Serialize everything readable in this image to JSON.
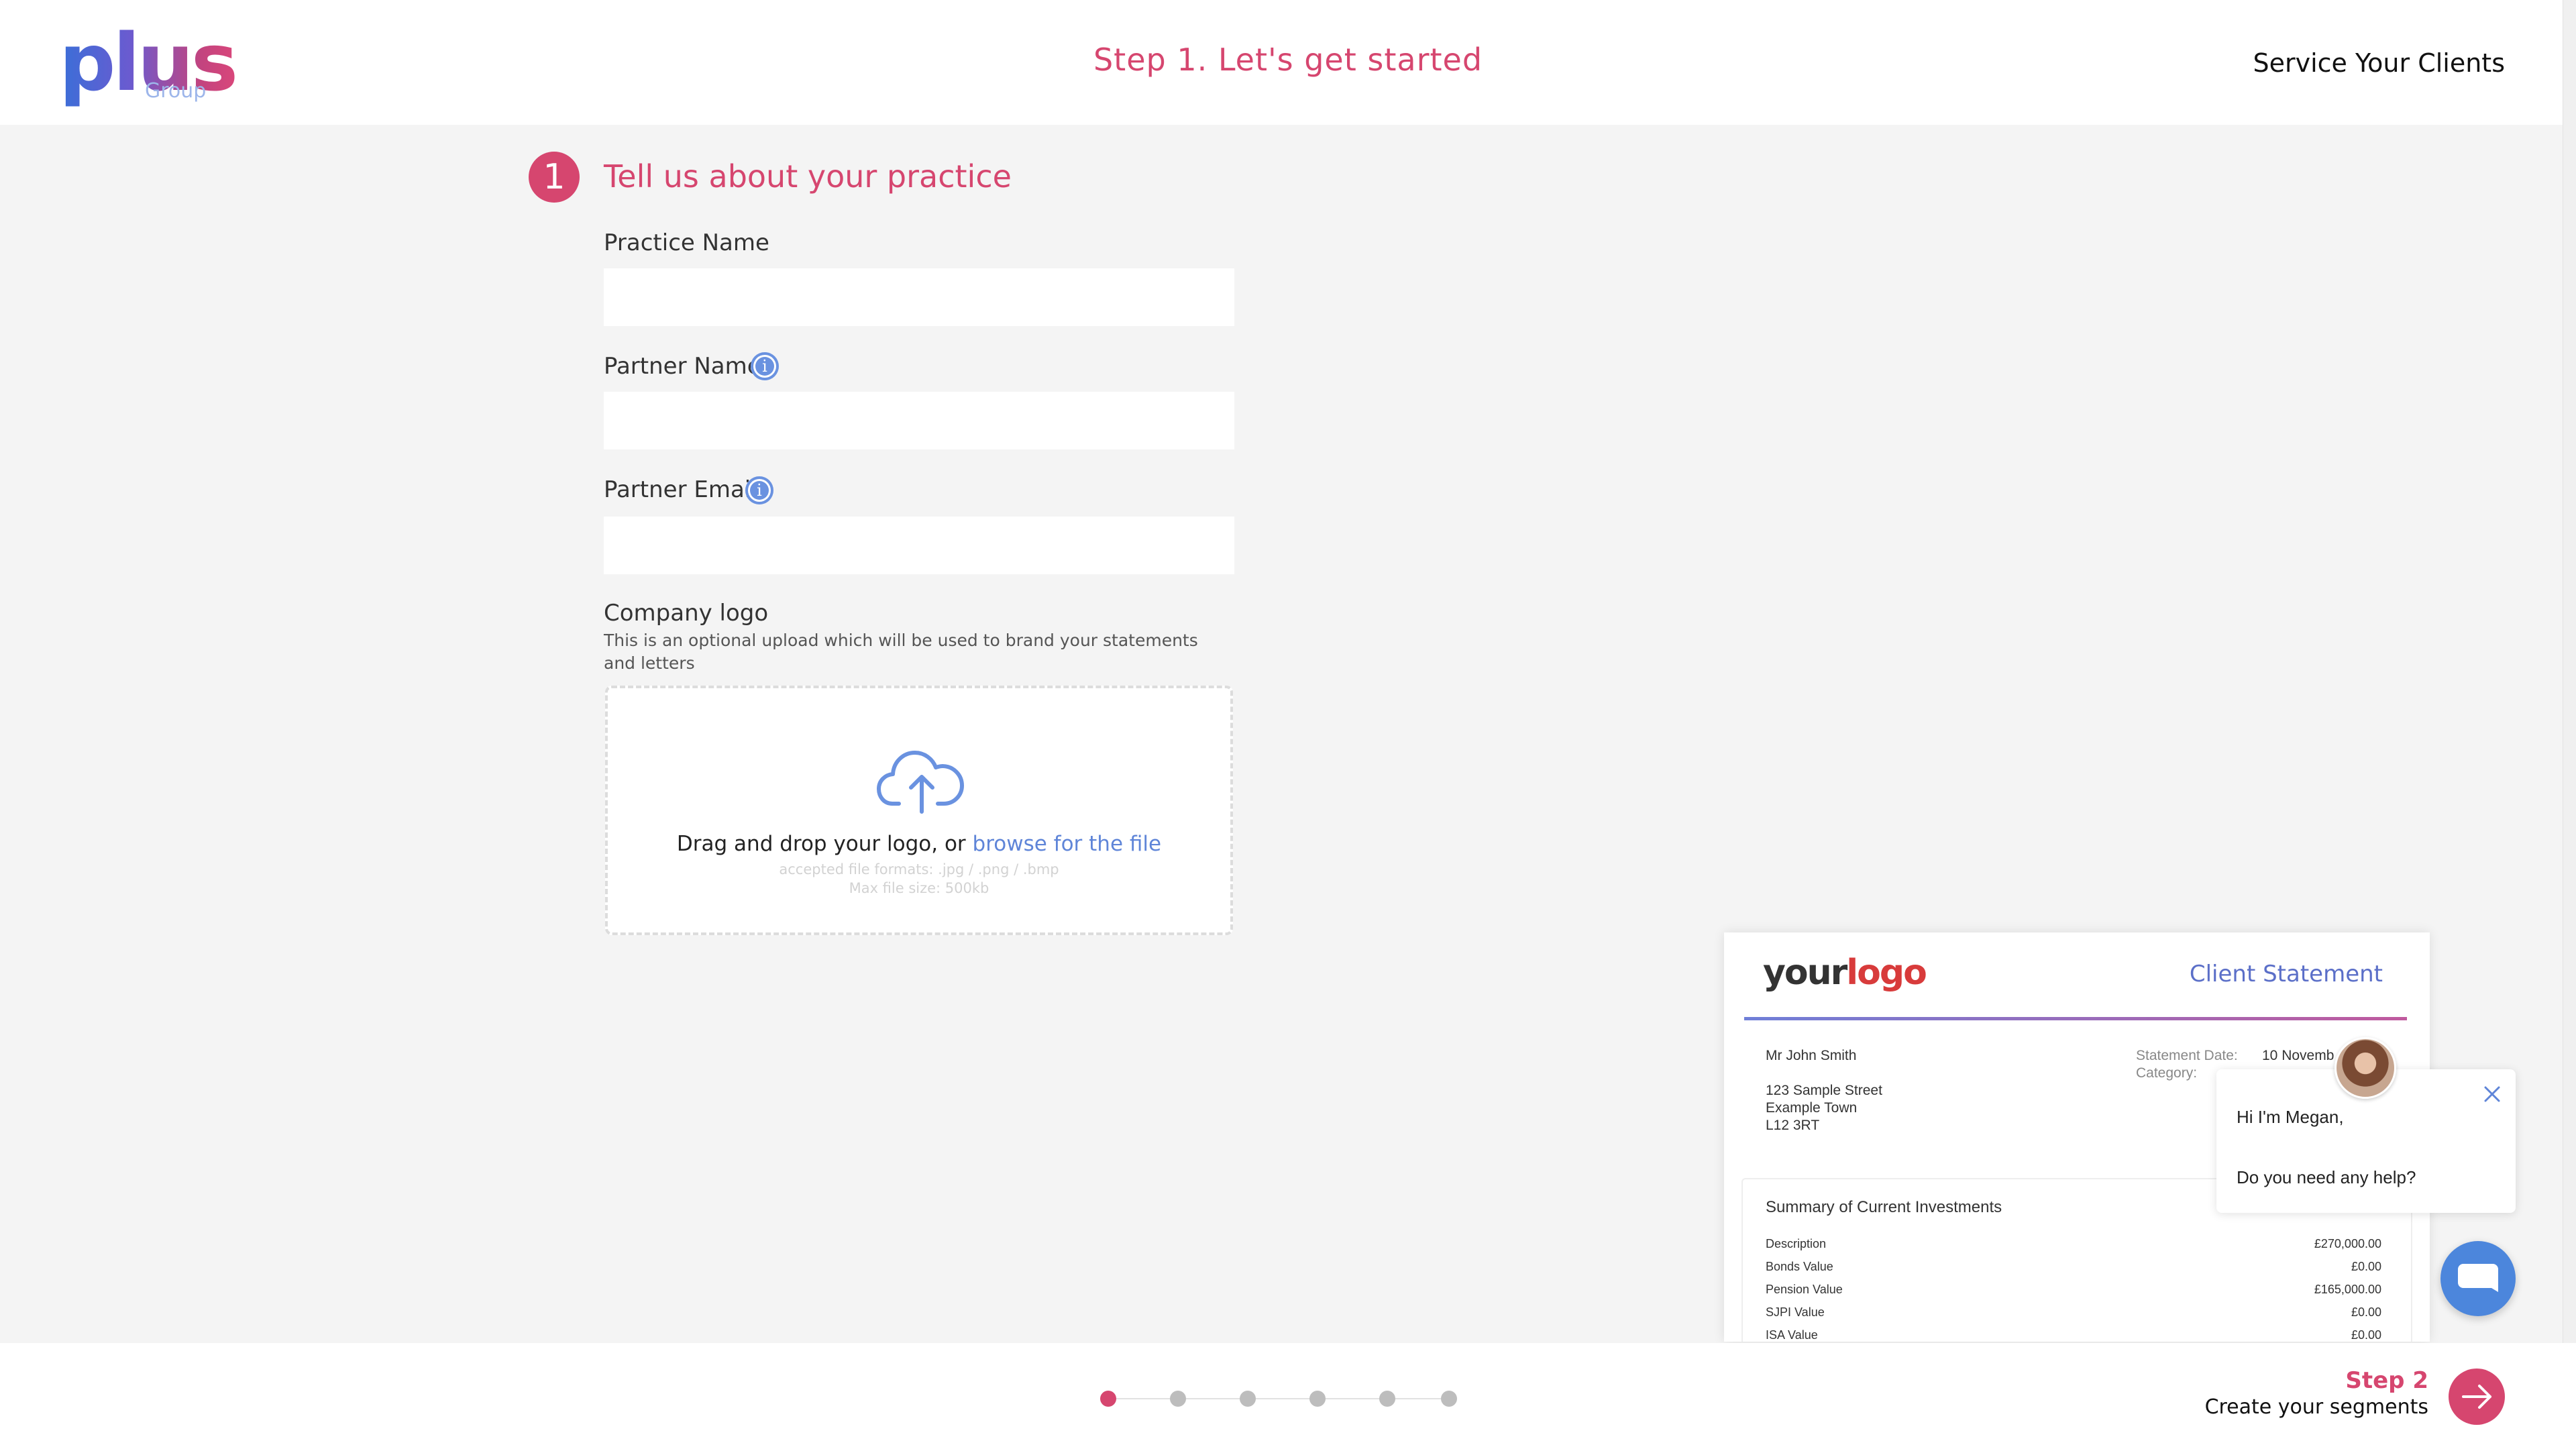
{
  "brand": {
    "logo_main": "plus",
    "logo_sub": "Group"
  },
  "header": {
    "step_title": "Step 1. Let's get started",
    "service_link": "Service Your Clients"
  },
  "section": {
    "number": "1",
    "heading": "Tell us about your practice"
  },
  "form": {
    "practice_name_label": "Practice Name",
    "practice_name_value": "",
    "partner_name_label": "Partner Name",
    "partner_name_value": "",
    "partner_email_label": "Partner Email",
    "partner_email_value": "",
    "company_logo_label": "Company logo",
    "company_logo_desc": "This is an optional upload which will be used to brand your statements and letters"
  },
  "upload": {
    "prompt": "Drag and drop your logo, or ",
    "browse_link": "browse for the file",
    "formats": "accepted file formats: .jpg / .png / .bmp",
    "max_size": "Max file size: 500kb"
  },
  "preview": {
    "logo_your": "your",
    "logo_logo": "logo",
    "title": "Client Statement",
    "client_name": "Mr John Smith",
    "address_1": "123 Sample Street",
    "address_2": "Example Town",
    "address_3": "L12 3RT",
    "statement_date_label": "Statement Date:",
    "statement_date_value": "10 Novemb",
    "category_label": "Category:",
    "summary_title": "Summary of Current Investments",
    "rows": [
      {
        "label": "Description",
        "value": "£270,000.00"
      },
      {
        "label": "Bonds Value",
        "value": "£0.00"
      },
      {
        "label": "Pension Value",
        "value": "£165,000.00"
      },
      {
        "label": "SJPI Value",
        "value": "£0.00"
      },
      {
        "label": "ISA Value",
        "value": "£0.00"
      }
    ]
  },
  "chat": {
    "greeting": "Hi I'm Megan,",
    "question": "Do you need any help?"
  },
  "footer": {
    "progress": {
      "current_step": 1,
      "total_steps": 6
    },
    "next_step_label": "Step 2",
    "next_step_desc": "Create your segments"
  },
  "colors": {
    "accent": "#d6466f",
    "link": "#5f85d8",
    "background": "#f4f4f4"
  }
}
